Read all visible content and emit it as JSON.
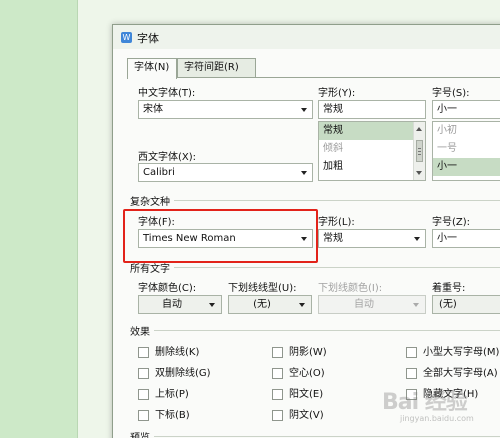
{
  "window": {
    "title": "字体",
    "icon": "W"
  },
  "tabs": [
    {
      "label": "字体(N)",
      "active": true
    },
    {
      "label": "字符间距(R)",
      "active": false
    }
  ],
  "chinese_font": {
    "label": "中文字体(T):",
    "value": "宋体"
  },
  "font_style": {
    "label": "字形(Y):",
    "value": "常规",
    "options": [
      "常规",
      "倾斜",
      "加粗"
    ],
    "selected_index": 0
  },
  "font_size": {
    "label": "字号(S):",
    "value": "小一",
    "options": [
      "小初",
      "一号",
      "小一"
    ],
    "selected_index": 2
  },
  "western_font": {
    "label": "西文字体(X):",
    "value": "Calibri"
  },
  "complex_script": {
    "section_title": "复杂文种",
    "font_label": "字体(F):",
    "font_value": "Times New Roman",
    "style_label": "字形(L):",
    "style_value": "常规",
    "size_label": "字号(Z):",
    "size_value": "小一"
  },
  "all_text": {
    "section_title": "所有文字",
    "font_color_label": "字体颜色(C):",
    "font_color_value": "自动",
    "underline_type_label": "下划线线型(U):",
    "underline_type_value": "(无)",
    "underline_color_label": "下划线颜色(I):",
    "underline_color_value": "自动",
    "emphasis_label": "着重号:",
    "emphasis_value": "(无)"
  },
  "effects": {
    "section_title": "效果",
    "items": [
      {
        "label": "删除线(K)"
      },
      {
        "label": "双删除线(G)"
      },
      {
        "label": "上标(P)"
      },
      {
        "label": "下标(B)"
      },
      {
        "label": "阴影(W)"
      },
      {
        "label": "空心(O)"
      },
      {
        "label": "阳文(E)"
      },
      {
        "label": "阴文(V)"
      },
      {
        "label": "小型大写字母(M)"
      },
      {
        "label": "全部大写字母(A)"
      },
      {
        "label": "隐藏文字(H)"
      }
    ]
  },
  "preview": {
    "section_title": "预览"
  },
  "watermark": {
    "text": "Bai 经验",
    "sub": "jingyan.baidu.com"
  },
  "colors": {
    "highlight": "#e2231a",
    "selection": "#c7dcc4",
    "background": "#c9e6c4"
  }
}
